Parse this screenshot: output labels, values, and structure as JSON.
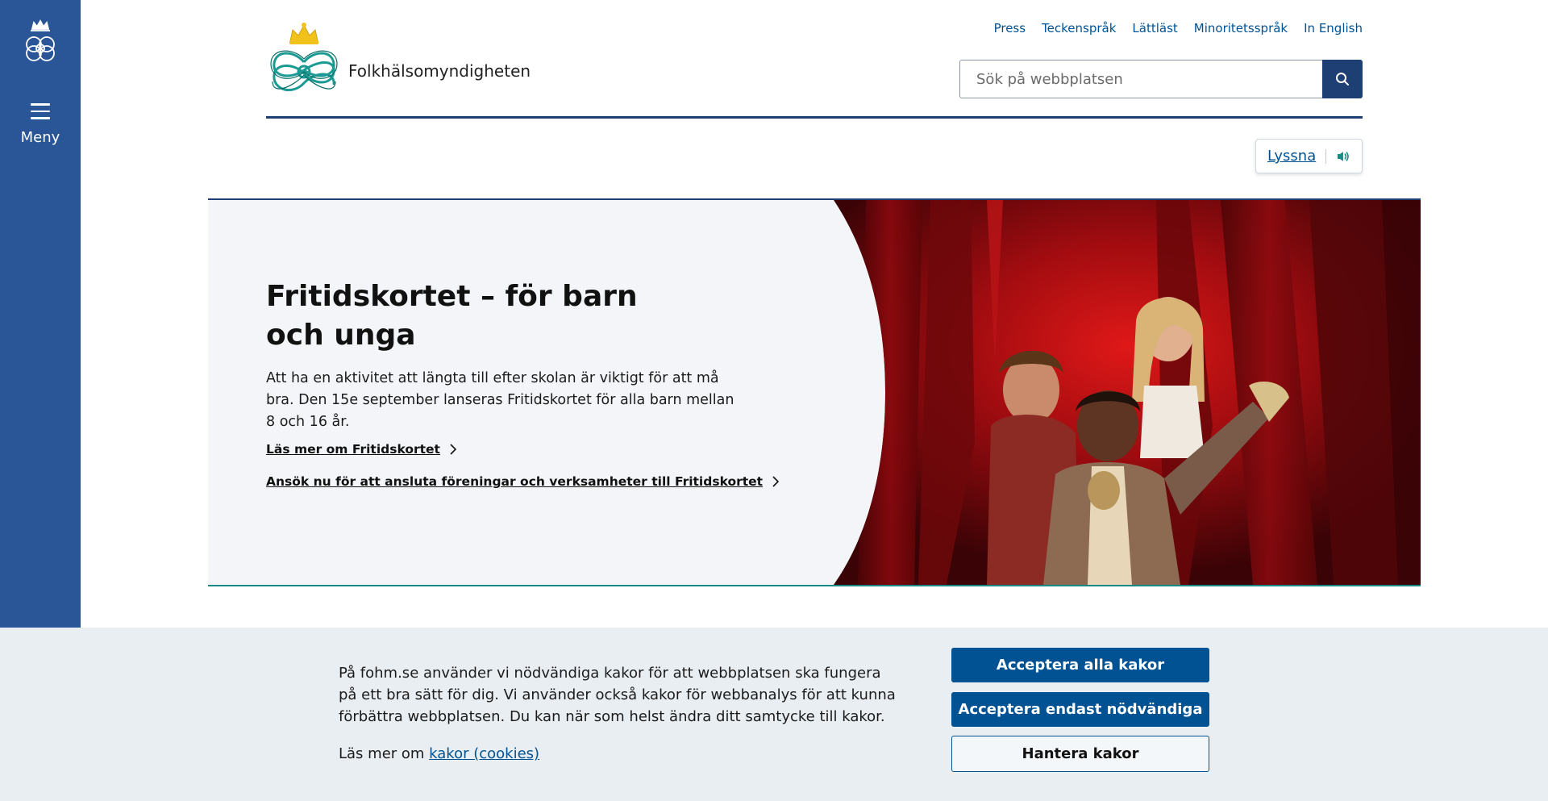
{
  "sidebar": {
    "menu_label": "Meny"
  },
  "header": {
    "brand_name": "Folkhälsomyndigheten",
    "top_links": [
      "Press",
      "Teckenspråk",
      "Lättläst",
      "Minoritetsspråk",
      "In English"
    ],
    "search": {
      "placeholder": "Sök på webbplatsen"
    },
    "listen_label": "Lyssna"
  },
  "hero": {
    "title": "Fritidskortet – för barn och unga",
    "text": "Att ha en aktivitet att längta till efter skolan är viktigt för att må bra. Den 15e september lanseras Fritidskortet för alla barn mellan 8 och 16 år.",
    "links": [
      "Läs mer om Fritidskortet",
      "Ansök nu för att ansluta föreningar och verksamheter till Fritidskortet"
    ]
  },
  "cookie_banner": {
    "text": "På fohm.se använder vi nödvändiga kakor för att webbplatsen ska fungera på ett bra sätt för dig. Vi använder också kakor för webbanalys för att kunna förbättra webbplatsen. Du kan när som helst ändra ditt samtycke till kakor.",
    "more_prefix": "Läs mer om ",
    "more_link": "kakor (cookies)",
    "buttons": {
      "accept_all": "Acceptera alla kakor",
      "accept_necessary": "Acceptera endast nödvändiga",
      "manage": "Hantera kakor"
    }
  },
  "colors": {
    "sidebar": "#2a5597",
    "link": "#005293",
    "navy": "#1d3f73",
    "teal": "#178a85",
    "hero_bg": "#f4f5f8",
    "cookie_bg": "#e9eef3"
  },
  "icons": [
    "crown-emblem-icon",
    "hamburger-menu-icon",
    "search-icon",
    "speaker-icon",
    "chevron-right-icon"
  ]
}
